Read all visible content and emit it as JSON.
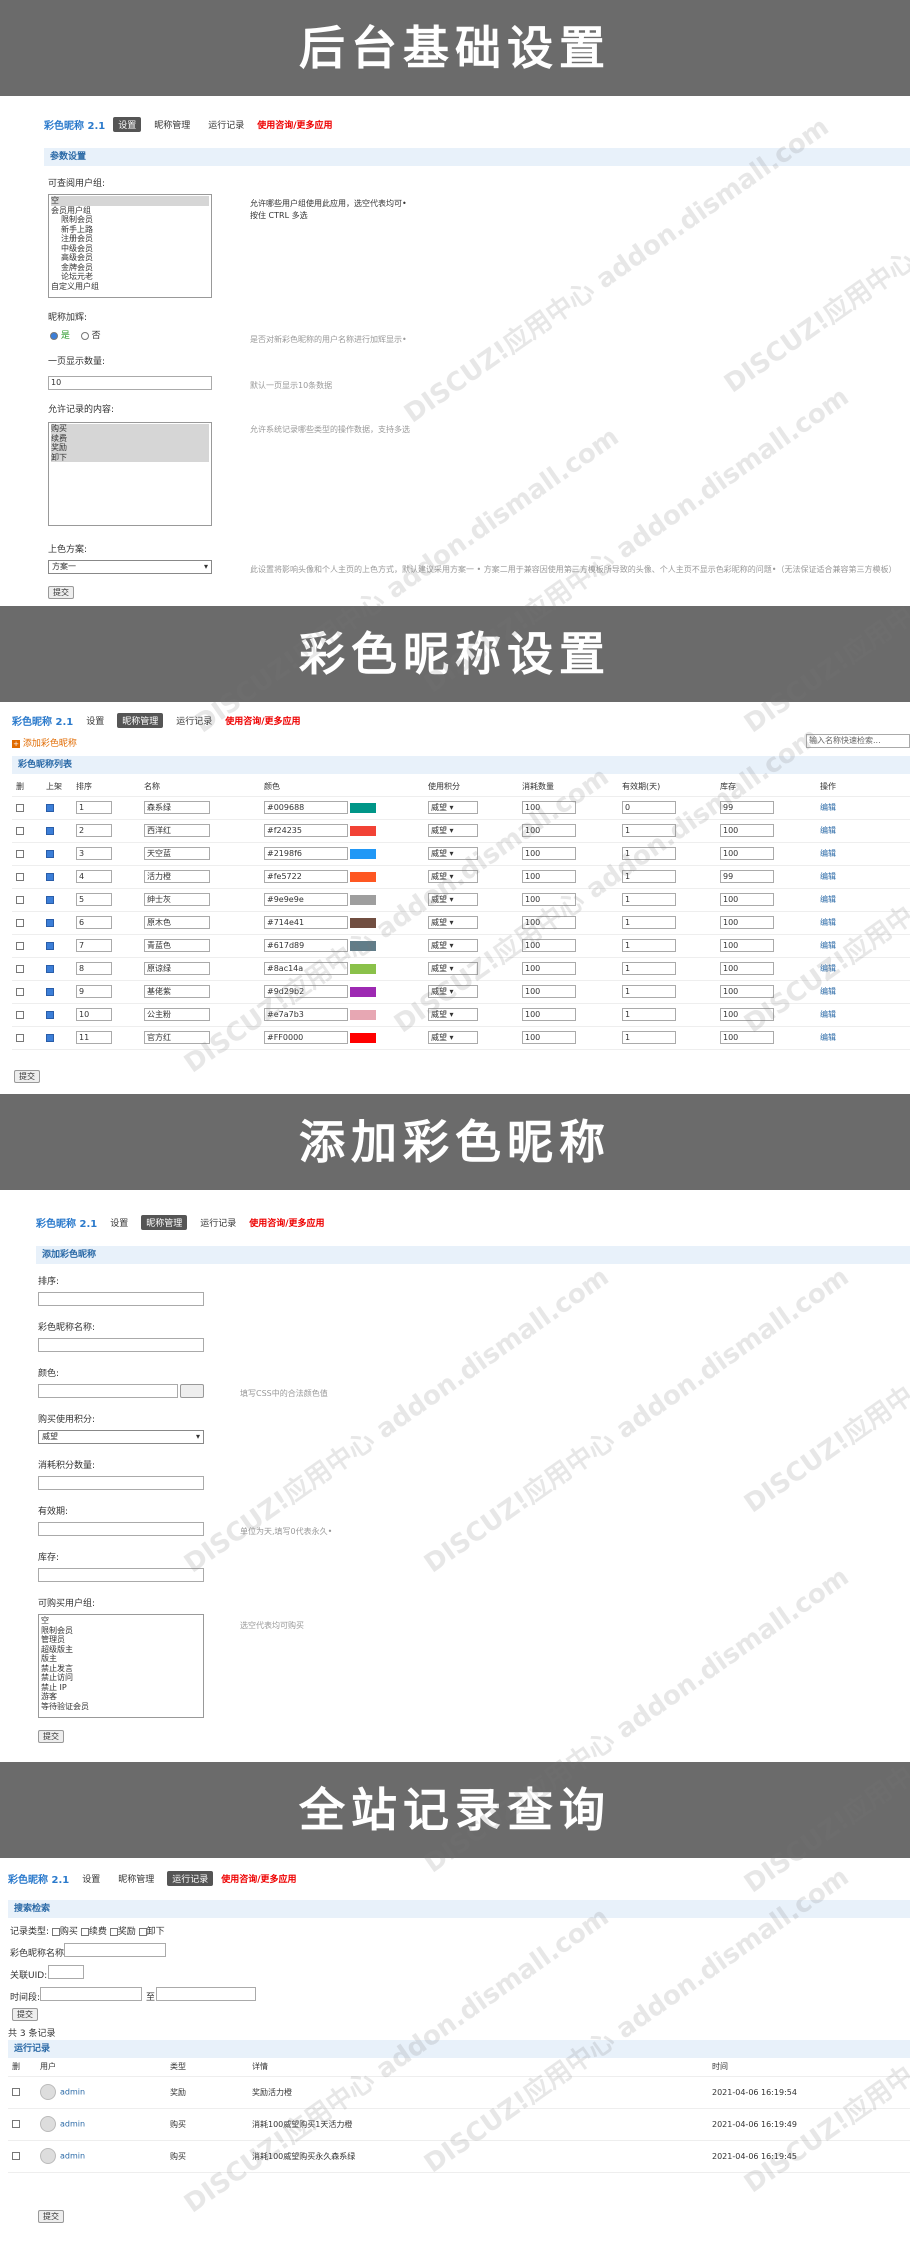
{
  "banners": [
    "后台基础设置",
    "彩色昵称设置",
    "添加彩色昵称",
    "全站记录查询"
  ],
  "app": {
    "title": "彩色昵称 2.1",
    "nav_settings": "设置",
    "nav_manage": "昵称管理",
    "nav_log": "运行记录",
    "nav_more": "使用咨询/更多应用"
  },
  "settings": {
    "section": "参数设置",
    "groups_label": "可查阅用户组:",
    "groups": [
      "空",
      "会员用户组",
      "限制会员",
      "新手上路",
      "注册会员",
      "中级会员",
      "高级会员",
      "金牌会员",
      "论坛元老",
      "自定义用户组"
    ],
    "groups_hint1": "允许哪些用户组使用此应用，选空代表均可•",
    "groups_hint2": "按住 CTRL 多选",
    "add_label": "昵称加辉:",
    "yes": "是",
    "no": "否",
    "add_hint": "是否对新彩色昵称的用户名称进行加辉显示•",
    "perpage_label": "一页显示数量:",
    "perpage_value": "10",
    "perpage_hint": "默认一页显示10条数据",
    "types_label": "允许记录的内容:",
    "types": [
      "购买",
      "续费",
      "奖励",
      "卸下"
    ],
    "types_hint": "允许系统记录哪些类型的操作数据，支持多选",
    "color_label": "上色方案:",
    "color_value": "方案一",
    "color_hint": "此设置将影响头像和个人主页的上色方式，默认建议采用方案一 • 方案二用于兼容因使用第三方模板所导致的头像、个人主页不显示色彩昵称的问题•（无法保证适合兼容第三方模板）",
    "submit": "提交"
  },
  "manage": {
    "add_link": "添加彩色昵称",
    "search_placeholder": "输入名称快速检索...",
    "section": "彩色昵称列表",
    "headers": [
      "删",
      "上架",
      "排序",
      "名称",
      "颜色",
      "使用积分",
      "消耗数量",
      "有效期(天)",
      "库存",
      "操作"
    ],
    "rows": [
      {
        "sort": "1",
        "name": "森系绿",
        "color": "#009688",
        "credit": "威望",
        "cost": "100",
        "days": "0",
        "stock": "99",
        "op": "编辑"
      },
      {
        "sort": "2",
        "name": "西洋红",
        "color": "#f24235",
        "credit": "威望",
        "cost": "100",
        "days": "1",
        "stock": "100",
        "op": "编辑"
      },
      {
        "sort": "3",
        "name": "天空蓝",
        "color": "#2198f6",
        "credit": "威望",
        "cost": "100",
        "days": "1",
        "stock": "100",
        "op": "编辑"
      },
      {
        "sort": "4",
        "name": "活力橙",
        "color": "#fe5722",
        "credit": "威望",
        "cost": "100",
        "days": "1",
        "stock": "99",
        "op": "编辑"
      },
      {
        "sort": "5",
        "name": "绅士灰",
        "color": "#9e9e9e",
        "credit": "威望",
        "cost": "100",
        "days": "1",
        "stock": "100",
        "op": "编辑"
      },
      {
        "sort": "6",
        "name": "原木色",
        "color": "#714e41",
        "credit": "威望",
        "cost": "100",
        "days": "1",
        "stock": "100",
        "op": "编辑"
      },
      {
        "sort": "7",
        "name": "青蓝色",
        "color": "#617d89",
        "credit": "威望",
        "cost": "100",
        "days": "1",
        "stock": "100",
        "op": "编辑"
      },
      {
        "sort": "8",
        "name": "原谅绿",
        "color": "#8ac14a",
        "credit": "威望",
        "cost": "100",
        "days": "1",
        "stock": "100",
        "op": "编辑"
      },
      {
        "sort": "9",
        "name": "基佬紫",
        "color": "#9d29b2",
        "credit": "威望",
        "cost": "100",
        "days": "1",
        "stock": "100",
        "op": "编辑"
      },
      {
        "sort": "10",
        "name": "公主粉",
        "color": "#e7a7b3",
        "credit": "威望",
        "cost": "100",
        "days": "1",
        "stock": "100",
        "op": "编辑"
      },
      {
        "sort": "11",
        "name": "官方红",
        "color": "#FF0000",
        "credit": "威望",
        "cost": "100",
        "days": "1",
        "stock": "100",
        "op": "编辑"
      }
    ],
    "submit": "提交"
  },
  "add": {
    "section": "添加彩色昵称",
    "sort_label": "排序:",
    "name_label": "彩色昵称名称:",
    "color_label": "颜色:",
    "color_hint": "填写CSS中的合法颜色值",
    "credit_label": "购买使用积分:",
    "credit_value": "威望",
    "cost_label": "消耗积分数量:",
    "days_label": "有效期:",
    "days_hint": "单位为天,填写0代表永久•",
    "stock_label": "库存:",
    "groups_label": "可购买用户组:",
    "groups": [
      "空",
      "限制会员",
      "管理员",
      "超级版主",
      "版主",
      "禁止发言",
      "禁止访问",
      "禁止 IP",
      "游客",
      "等待验证会员"
    ],
    "groups_hint": "选空代表均可购买",
    "submit": "提交"
  },
  "log": {
    "search_section": "搜索检索",
    "type_label": "记录类型:",
    "types": [
      "购买",
      "续费",
      "奖励",
      "卸下"
    ],
    "name_label": "彩色昵称名称:",
    "uid_label": "关联UID:",
    "time_label": "时间段:",
    "time_to": "至",
    "submit": "提交",
    "count": "共 3 条记录",
    "list_section": "运行记录",
    "headers": [
      "删",
      "用户",
      "类型",
      "详情",
      "时间"
    ],
    "rows": [
      {
        "user": "admin",
        "type": "奖励",
        "detail": "奖励活力橙",
        "time": "2021-04-06 16:19:54"
      },
      {
        "user": "admin",
        "type": "购买",
        "detail": "消耗100威望购买1天活力橙",
        "time": "2021-04-06 16:19:49"
      },
      {
        "user": "admin",
        "type": "购买",
        "detail": "消耗100威望购买永久森系绿",
        "time": "2021-04-06 16:19:45"
      }
    ]
  },
  "watermark": "DISCUZ!应用中心 addon.dismall.com"
}
